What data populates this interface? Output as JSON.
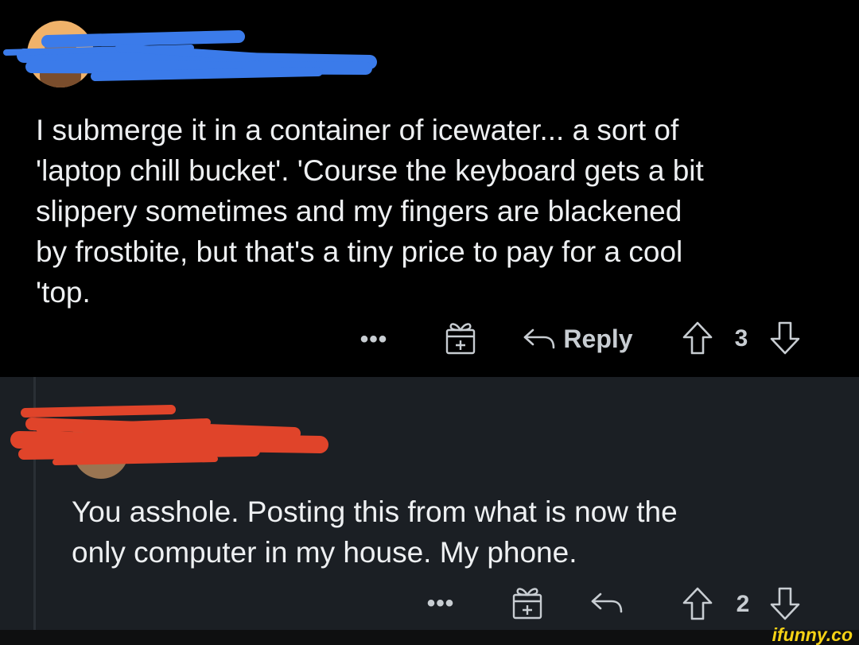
{
  "comments": [
    {
      "text": "I submerge it in a container of icewater... a sort of\n'laptop chill bucket'. 'Course the keyboard gets a bit\nslippery sometimes and my fingers are blackened\nby frostbite, but that's a tiny price to pay for a cool\n'top.",
      "more_label": "•••",
      "reply_label": "Reply",
      "vote_count": "3",
      "scribble_color": "#3b7bea"
    },
    {
      "text": "You asshole. Posting this from what is now the\nonly computer in my house. My phone.",
      "more_label": "•••",
      "vote_count": "2",
      "scribble_color": "#e0442a"
    }
  ],
  "watermark": "ifunny.co",
  "colors": {
    "background_top": "#000000",
    "background_reply": "#1b1f24",
    "text": "#eef0f2",
    "icon": "#c8cdd2",
    "watermark": "#f6d215"
  }
}
